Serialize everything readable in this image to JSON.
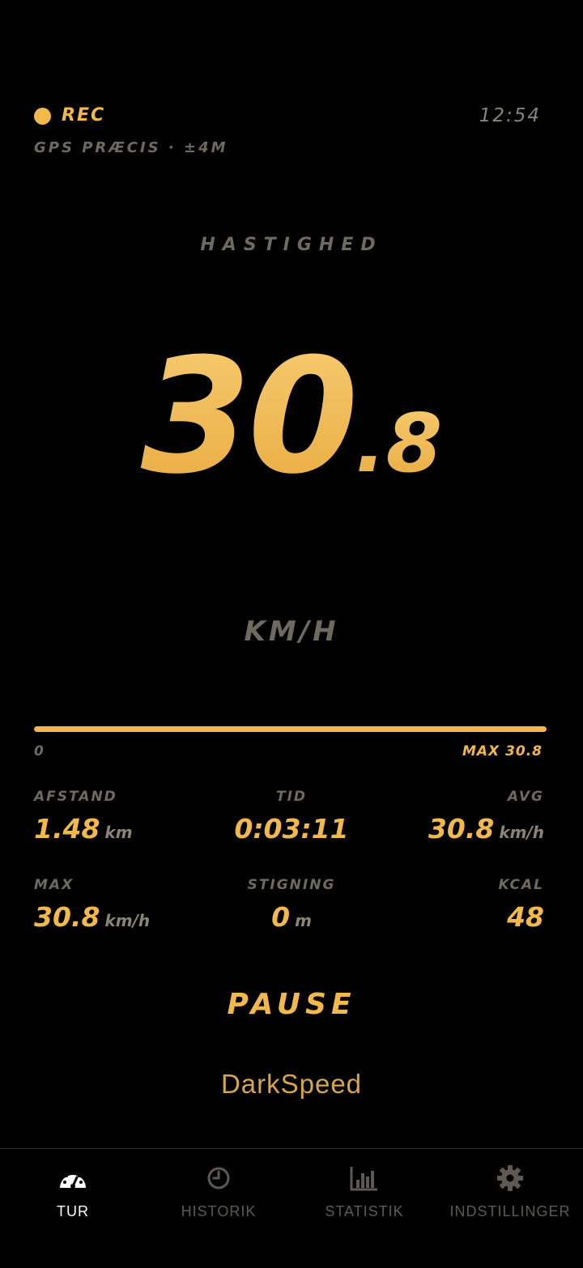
{
  "status": {
    "rec_label": "REC",
    "clock": "12:54",
    "gps": "GPS PRÆCIS · ±4M"
  },
  "speed": {
    "caption": "HASTIGHED",
    "integer": "30",
    "decimal": ".8",
    "unit": "KM/H"
  },
  "progress": {
    "min_label": "0",
    "max_label": "MAX 30.8",
    "fraction": 1.0
  },
  "stats": {
    "distance": {
      "label": "AFSTAND",
      "value": "1.48",
      "unit": "km"
    },
    "time": {
      "label": "TID",
      "value": "0:03:11"
    },
    "avg": {
      "label": "AVG",
      "value": "30.8",
      "unit": "km/h"
    },
    "max": {
      "label": "MAX",
      "value": "30.8",
      "unit": "km/h"
    },
    "climb": {
      "label": "STIGNING",
      "value": "0",
      "unit": "m"
    },
    "kcal": {
      "label": "KCAL",
      "value": "48"
    }
  },
  "pause_label": "PAUSE",
  "brand": "DarkSpeed",
  "nav": [
    {
      "label": "TUR",
      "icon": "speedometer-icon",
      "active": true
    },
    {
      "label": "HISTORIK",
      "icon": "clock-icon",
      "active": false
    },
    {
      "label": "STATISTIK",
      "icon": "bar-chart-icon",
      "active": false
    },
    {
      "label": "INDSTILLINGER",
      "icon": "gear-icon",
      "active": false
    }
  ],
  "colors": {
    "accent": "#f2b94a",
    "background": "#000000",
    "muted": "#6f6a60",
    "nav_active": "#ffffff",
    "nav_inactive": "#5e5a53"
  }
}
